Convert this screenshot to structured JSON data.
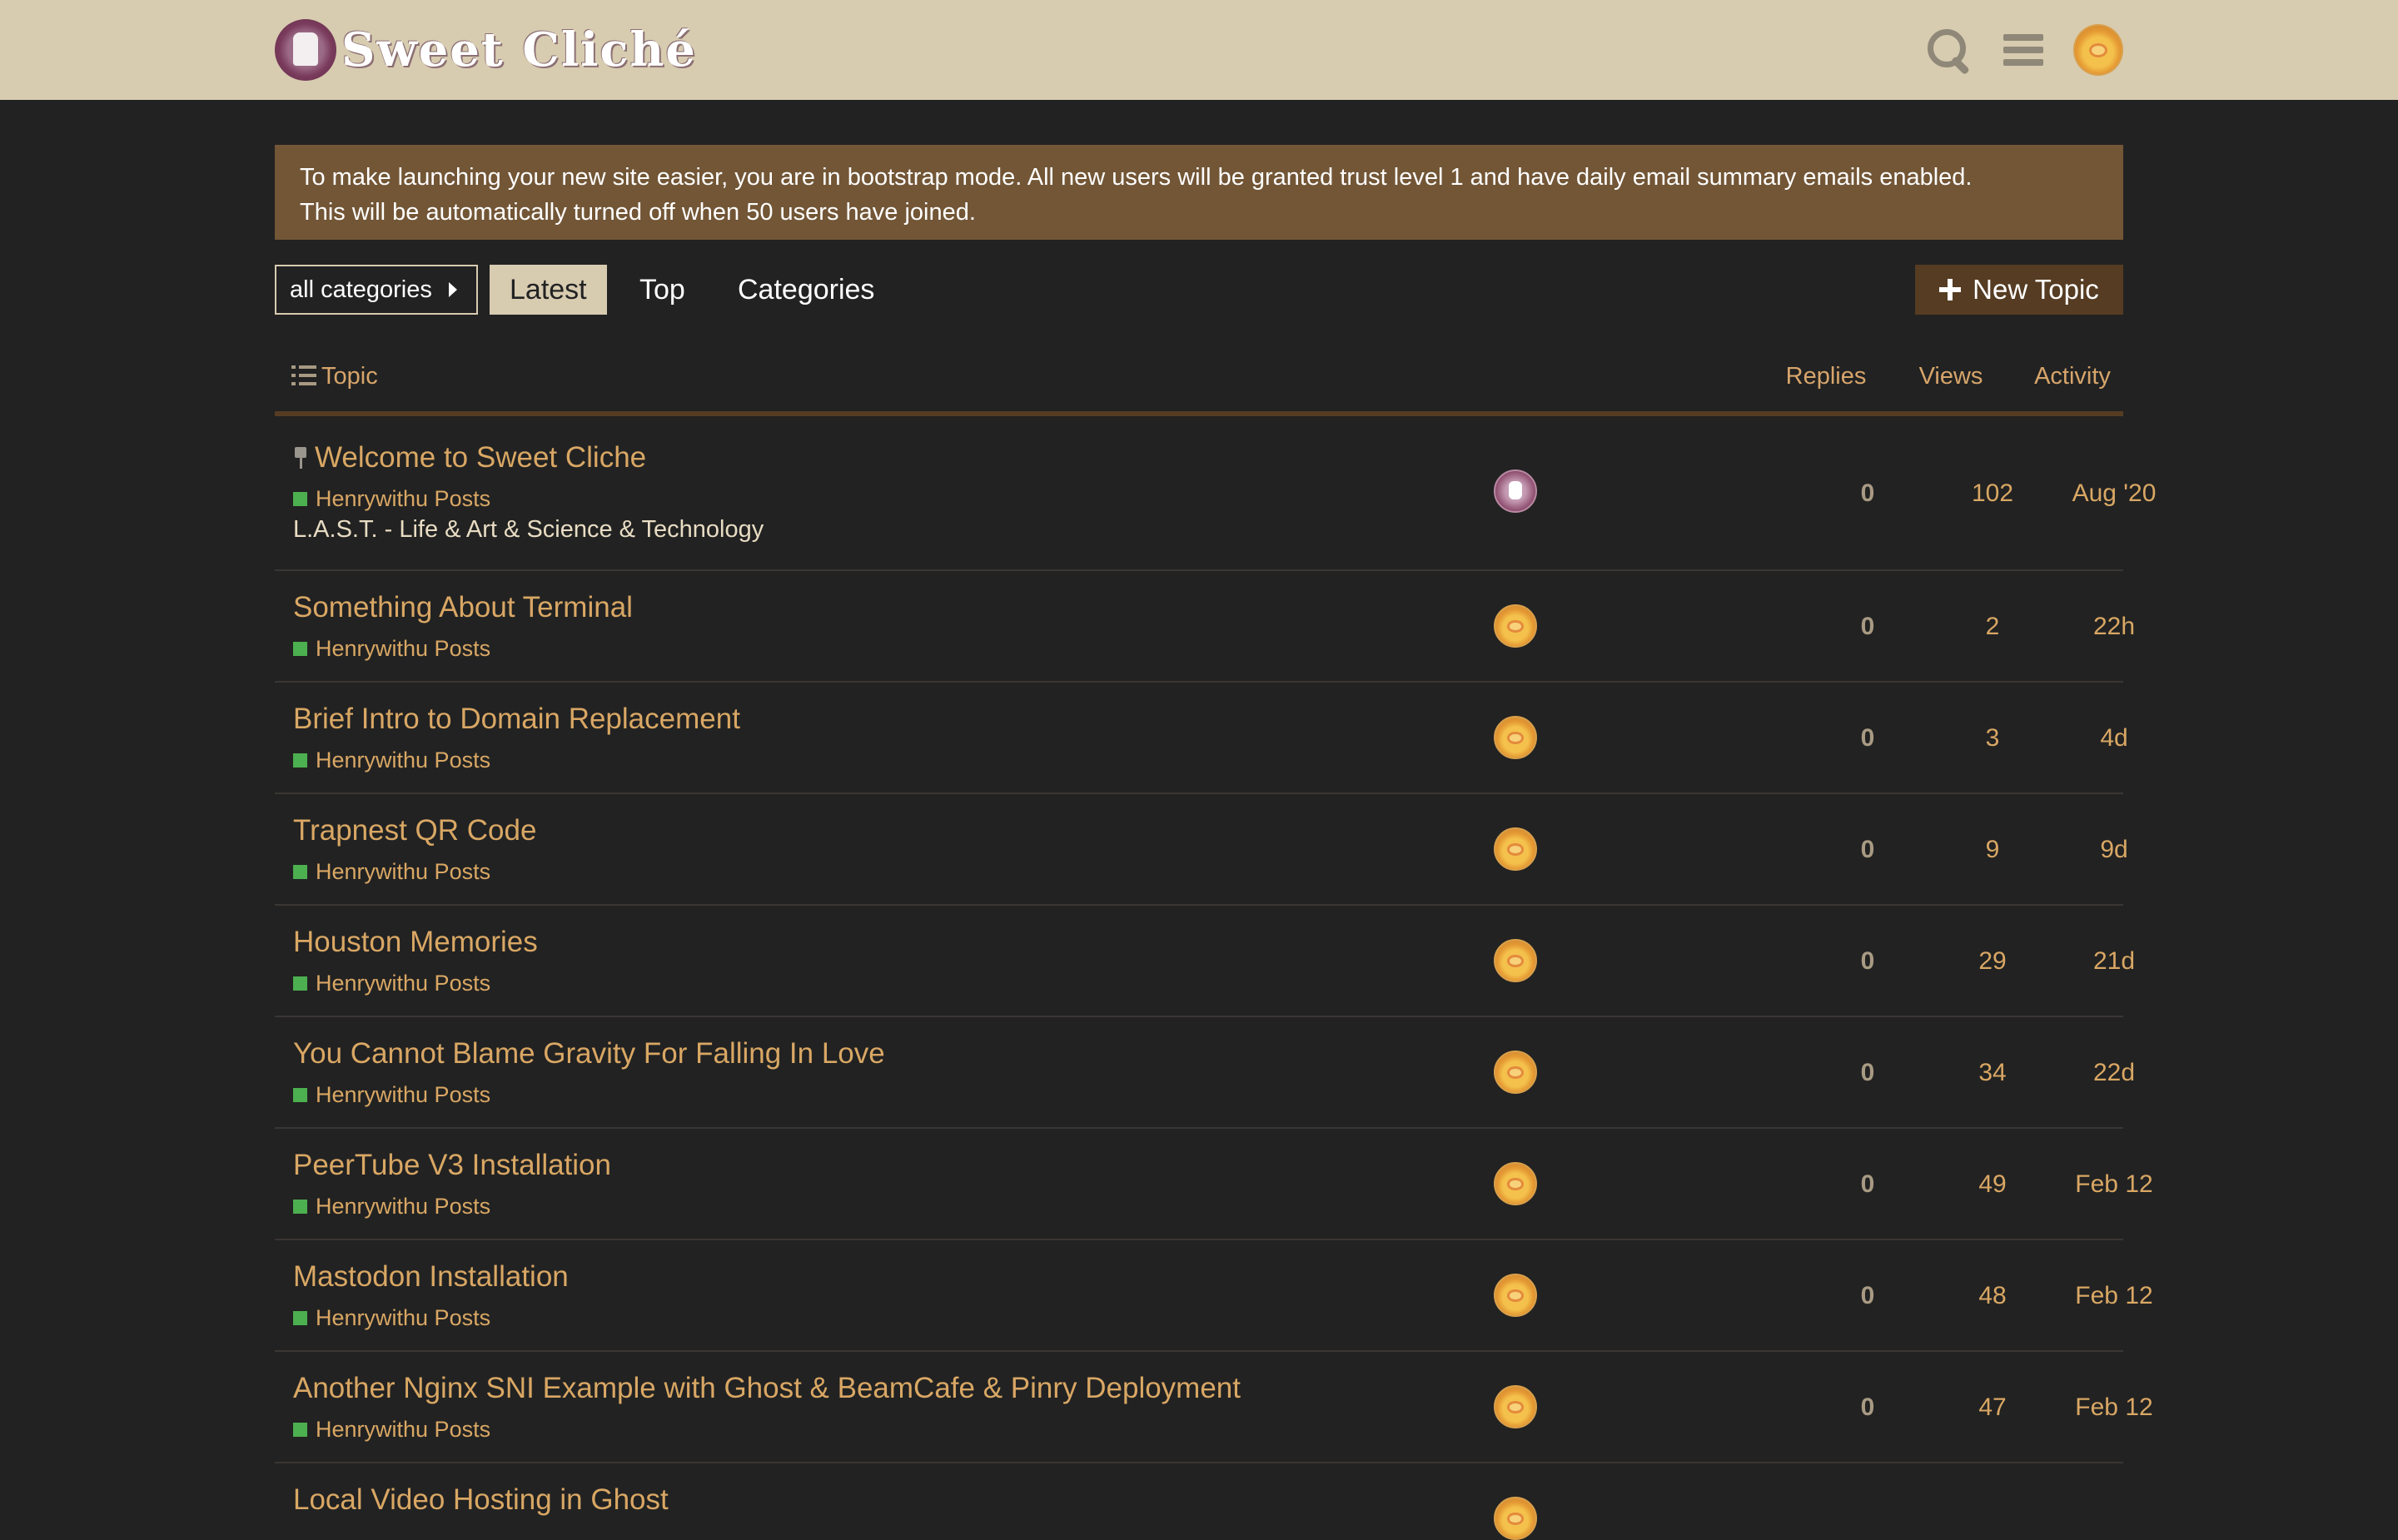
{
  "header": {
    "site_name": "Sweet Cliché",
    "search_icon": "search-icon",
    "menu_icon": "hamburger-menu-icon",
    "user_avatar": "user-avatar"
  },
  "banner": {
    "line1": "To make launching your new site easier, you are in bootstrap mode. All new users will be granted trust level 1 and have daily email summary emails enabled.",
    "line2": "This will be automatically turned off when 50 users have joined."
  },
  "nav": {
    "category_dropdown": "all categories",
    "tabs": [
      {
        "label": "Latest",
        "active": true
      },
      {
        "label": "Top",
        "active": false
      },
      {
        "label": "Categories",
        "active": false
      }
    ],
    "new_topic": "New Topic"
  },
  "table": {
    "headers": {
      "topic": "Topic",
      "replies": "Replies",
      "views": "Views",
      "activity": "Activity"
    },
    "rows": [
      {
        "title": "Welcome to Sweet Cliche",
        "pinned": true,
        "category": "Henrywithu Posts",
        "excerpt": "L.A.S.T. - Life & Art & Science & Technology",
        "replies": "0",
        "views": "102",
        "activity": "Aug '20"
      },
      {
        "title": "Something About Terminal",
        "category": "Henrywithu Posts",
        "replies": "0",
        "views": "2",
        "activity": "22h"
      },
      {
        "title": "Brief Intro to Domain Replacement",
        "category": "Henrywithu Posts",
        "replies": "0",
        "views": "3",
        "activity": "4d"
      },
      {
        "title": "Trapnest QR Code",
        "category": "Henrywithu Posts",
        "replies": "0",
        "views": "9",
        "activity": "9d"
      },
      {
        "title": "Houston Memories",
        "category": "Henrywithu Posts",
        "replies": "0",
        "views": "29",
        "activity": "21d"
      },
      {
        "title": "You Cannot Blame Gravity For Falling In Love",
        "category": "Henrywithu Posts",
        "replies": "0",
        "views": "34",
        "activity": "22d"
      },
      {
        "title": "PeerTube V3 Installation",
        "category": "Henrywithu Posts",
        "replies": "0",
        "views": "49",
        "activity": "Feb 12"
      },
      {
        "title": "Mastodon Installation",
        "category": "Henrywithu Posts",
        "replies": "0",
        "views": "48",
        "activity": "Feb 12"
      },
      {
        "title": "Another Nginx SNI Example with Ghost & BeamCafe & Pinry Deployment",
        "category": "Henrywithu Posts",
        "replies": "0",
        "views": "47",
        "activity": "Feb 12"
      }
    ],
    "partial_row_title": "Local Video Hosting in Ghost"
  },
  "colors": {
    "header_bg": "#d7cbb0",
    "page_bg": "#222222",
    "banner_bg": "#725636",
    "accent": "#d9a764",
    "category_square": "#4caf50",
    "new_topic_bg": "#553c22"
  }
}
